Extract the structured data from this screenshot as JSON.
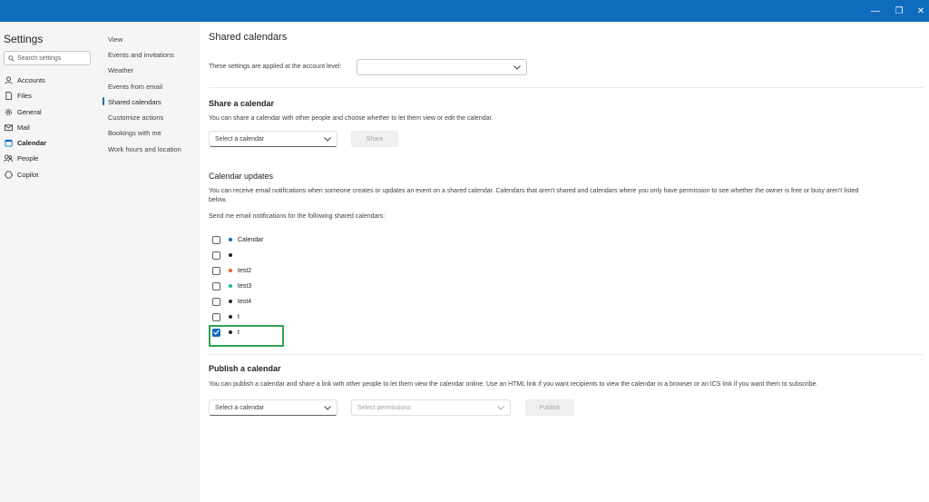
{
  "window": {
    "controls": {
      "minimize": "—",
      "maximize": "❐",
      "close": "✕"
    }
  },
  "nav": {
    "title": "Settings",
    "search_placeholder": "Search settings",
    "items": [
      {
        "label": "Accounts",
        "icon": "person-icon"
      },
      {
        "label": "Files",
        "icon": "file-icon"
      },
      {
        "label": "General",
        "icon": "gear-icon"
      },
      {
        "label": "Mail",
        "icon": "mail-icon"
      },
      {
        "label": "Calendar",
        "icon": "calendar-icon",
        "active": true
      },
      {
        "label": "People",
        "icon": "people-icon"
      },
      {
        "label": "Copilot",
        "icon": "copilot-icon"
      }
    ]
  },
  "subnav": {
    "items": [
      {
        "label": "View"
      },
      {
        "label": "Events and invitations"
      },
      {
        "label": "Weather"
      },
      {
        "label": "Events from email"
      },
      {
        "label": "Shared calendars",
        "active": true
      },
      {
        "label": "Customize actions"
      },
      {
        "label": "Bookings with me"
      },
      {
        "label": "Work hours and location"
      }
    ]
  },
  "main": {
    "title": "Shared calendars",
    "account_level_label": "These settings are applied at the account level:",
    "account_select_value": "",
    "share": {
      "title": "Share a calendar",
      "description": "You can share a calendar with other people and choose whether to let them view or edit the calendar.",
      "select_placeholder": "Select a calendar",
      "button_label": "Share"
    },
    "updates": {
      "title": "Calendar updates",
      "description_line1": "You can receive email notifications when someone creates or updates an event on a shared calendar. Calendars that aren't shared and calendars where you only have permission to see whether the owner is free or busy aren't listed",
      "description_line2": "below.",
      "prompt": "Send me email notifications for the following shared calendars:",
      "calendars": [
        {
          "name": "Calendar",
          "color": "#0f6cbd",
          "checked": false
        },
        {
          "name": "",
          "color": "#242424",
          "checked": false
        },
        {
          "name": "test2",
          "color": "#e8622c",
          "checked": false
        },
        {
          "name": "test3",
          "color": "#13c0a0",
          "checked": false
        },
        {
          "name": "test4",
          "color": "#242424",
          "checked": false
        },
        {
          "name": "t",
          "color": "#242424",
          "checked": false
        },
        {
          "name": "t",
          "color": "#242424",
          "checked": true
        }
      ]
    },
    "publish": {
      "title": "Publish a calendar",
      "description": "You can publish a calendar and share a link with other people to let them view the calendar online. Use an HTML link if you want recipients to view the calendar in a browser or an ICS link if you want them to subscribe.",
      "select_placeholder": "Select a calendar",
      "permissions_placeholder": "Select permissions",
      "button_label": "Publish"
    }
  }
}
